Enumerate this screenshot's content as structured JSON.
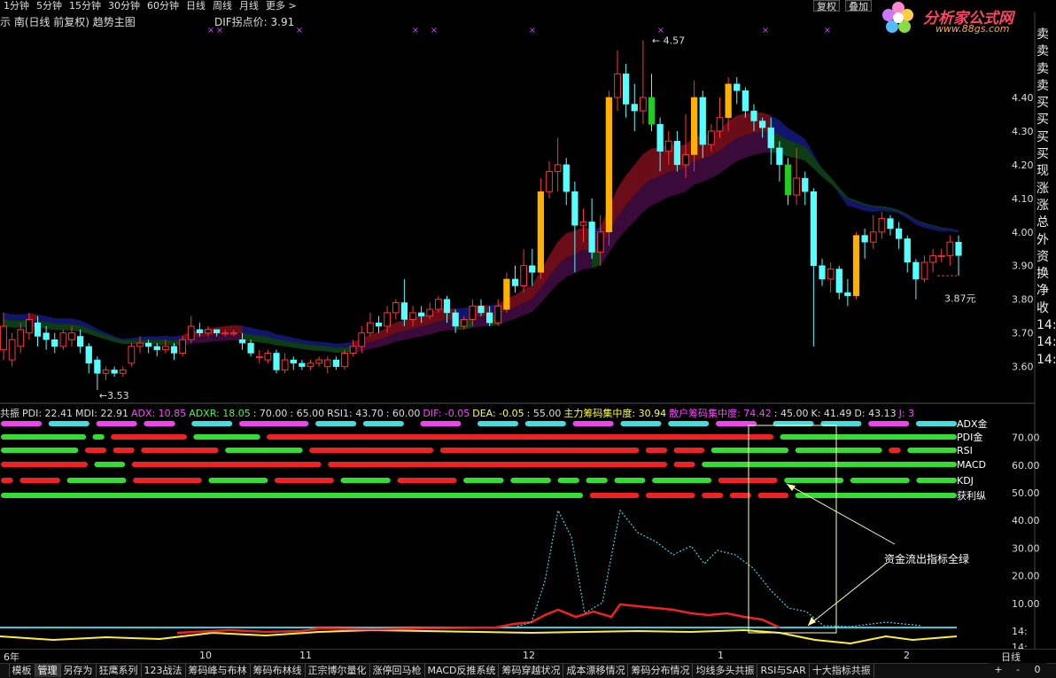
{
  "toolbar": {
    "items": [
      "1分钟",
      "5分钟",
      "15分钟",
      "30分钟",
      "60分钟",
      "日线",
      "周线",
      "月线",
      "更多 >"
    ],
    "restore_btn": "复权",
    "overlay_btn": "叠加"
  },
  "chart_header": {
    "title": "示 南(日线 前复权) 趋势主图",
    "dif_label": "DIF拐点价: 3.91"
  },
  "logo": {
    "name": "分析家公式网",
    "url": "www.88gs.com"
  },
  "price_axis": [
    "4.40",
    "4.30",
    "4.20",
    "4.10",
    "4.00",
    "3.90",
    "3.80",
    "3.70",
    "3.60"
  ],
  "annotations": {
    "high": "4.57",
    "low": "3.53",
    "last": "3.87元"
  },
  "right_panel": [
    "卖",
    "卖",
    "卖",
    "卖",
    "买",
    "买",
    "买",
    "买",
    "现",
    "涨",
    "涨",
    "总",
    "外",
    "资",
    "换",
    "净",
    "收",
    "14:",
    "14:",
    "14:"
  ],
  "indicator_line": [
    {
      "text": "共振",
      "color": "#dddddd"
    },
    {
      "text": "PDI: 22.41",
      "color": "#dddddd"
    },
    {
      "text": "MDI: 22.91",
      "color": "#dddddd"
    },
    {
      "text": "ADX: 10.85",
      "color": "#ff44ff"
    },
    {
      "text": "ADXR: 18.05",
      "color": "#55ee55"
    },
    {
      "text": ": 70.00",
      "color": "#dddddd"
    },
    {
      "text": ": 65.00",
      "color": "#dddddd"
    },
    {
      "text": "RSI1: 43.70",
      "color": "#dddddd"
    },
    {
      "text": ": 60.00",
      "color": "#dddddd"
    },
    {
      "text": "DIF: -0.05",
      "color": "#ff44ff"
    },
    {
      "text": "DEA: -0.05",
      "color": "#ffff44"
    },
    {
      "text": ": 55.00",
      "color": "#dddddd"
    },
    {
      "text": "主力筹码集中度: 30.94",
      "color": "#ffff44"
    },
    {
      "text": "散户筹码集中度: 74.42",
      "color": "#ff44ff"
    },
    {
      "text": ": 45.00",
      "color": "#dddddd"
    },
    {
      "text": "K: 41.49",
      "color": "#dddddd"
    },
    {
      "text": "D: 43.13",
      "color": "#dddddd"
    },
    {
      "text": "J: 3",
      "color": "#ff44ff"
    }
  ],
  "signal_rows": [
    "ADX金",
    "PDI金",
    "RSI",
    "MACD",
    "KDJ",
    "获利纵"
  ],
  "sub_axis": [
    "70.00",
    "60.00",
    "50.00",
    "40.00",
    "30.00",
    "20.00",
    "10.00"
  ],
  "callout": "资金流出指标全绿",
  "x_axis": {
    "labels": [
      "6年",
      "10",
      "11",
      "12",
      "1",
      "2"
    ],
    "period": "日线"
  },
  "bottom_tabs": [
    "模板",
    "管理",
    "另存为",
    "狂鹰系列",
    "123战法",
    "筹码峰与布林",
    "筹码布林线",
    "正宗博尔量化",
    "涨停回马枪",
    "MACD反推系统",
    "筹码穿越状况",
    "成本漂移情况",
    "筹码分布情况",
    "均线多头共振",
    "RSI与SAR",
    "十大指标共振"
  ],
  "bottom_controls": [
    "+",
    "-",
    "0"
  ],
  "colors": {
    "up": "#ff3333",
    "down": "#55ffff",
    "yellow": "#ffcc00",
    "green": "#22cc22",
    "cyan": "#33ccdd"
  },
  "chart_data": {
    "type": "candlestick",
    "ylim": [
      3.52,
      4.6
    ],
    "candles": [
      [
        3.65,
        3.72,
        3.62,
        3.76
      ],
      [
        3.62,
        3.68,
        3.6,
        3.7
      ],
      [
        3.66,
        3.71,
        3.64,
        3.73
      ],
      [
        3.7,
        3.74,
        3.68,
        3.76
      ],
      [
        3.73,
        3.69,
        3.66,
        3.75
      ],
      [
        3.7,
        3.68,
        3.65,
        3.72
      ],
      [
        3.68,
        3.66,
        3.64,
        3.7
      ],
      [
        3.66,
        3.7,
        3.65,
        3.71
      ],
      [
        3.68,
        3.7,
        3.66,
        3.72
      ],
      [
        3.69,
        3.66,
        3.64,
        3.71
      ],
      [
        3.66,
        3.61,
        3.58,
        3.67
      ],
      [
        3.62,
        3.58,
        3.53,
        3.63
      ],
      [
        3.58,
        3.59,
        3.56,
        3.6
      ],
      [
        3.59,
        3.58,
        3.57,
        3.6
      ],
      [
        3.58,
        3.59,
        3.57,
        3.6
      ],
      [
        3.61,
        3.66,
        3.6,
        3.67
      ],
      [
        3.66,
        3.67,
        3.64,
        3.69
      ],
      [
        3.67,
        3.66,
        3.64,
        3.68
      ],
      [
        3.66,
        3.65,
        3.63,
        3.67
      ],
      [
        3.65,
        3.66,
        3.64,
        3.68
      ],
      [
        3.66,
        3.64,
        3.62,
        3.67
      ],
      [
        3.64,
        3.68,
        3.63,
        3.69
      ],
      [
        3.68,
        3.72,
        3.67,
        3.75
      ],
      [
        3.71,
        3.7,
        3.69,
        3.73
      ],
      [
        3.7,
        3.71,
        3.69,
        3.72
      ],
      [
        3.71,
        3.7,
        3.69,
        3.71
      ],
      [
        3.7,
        3.7,
        3.69,
        3.71
      ],
      [
        3.7,
        3.7,
        3.69,
        3.71
      ],
      [
        3.68,
        3.67,
        3.65,
        3.7
      ],
      [
        3.67,
        3.64,
        3.63,
        3.68
      ],
      [
        3.63,
        3.63,
        3.61,
        3.65
      ],
      [
        3.62,
        3.64,
        3.61,
        3.65
      ],
      [
        3.64,
        3.59,
        3.58,
        3.65
      ],
      [
        3.59,
        3.62,
        3.58,
        3.64
      ],
      [
        3.62,
        3.61,
        3.59,
        3.63
      ],
      [
        3.61,
        3.6,
        3.59,
        3.62
      ],
      [
        3.6,
        3.61,
        3.59,
        3.62
      ],
      [
        3.61,
        3.62,
        3.6,
        3.63
      ],
      [
        3.6,
        3.62,
        3.58,
        3.63
      ],
      [
        3.62,
        3.6,
        3.59,
        3.63
      ],
      [
        3.6,
        3.64,
        3.59,
        3.65
      ],
      [
        3.64,
        3.66,
        3.63,
        3.68
      ],
      [
        3.66,
        3.7,
        3.64,
        3.72
      ],
      [
        3.7,
        3.73,
        3.69,
        3.76
      ],
      [
        3.73,
        3.72,
        3.7,
        3.75
      ],
      [
        3.72,
        3.76,
        3.7,
        3.78
      ],
      [
        3.76,
        3.79,
        3.74,
        3.8
      ],
      [
        3.79,
        3.74,
        3.72,
        3.86
      ],
      [
        3.74,
        3.76,
        3.72,
        3.78
      ],
      [
        3.76,
        3.75,
        3.73,
        3.78
      ],
      [
        3.75,
        3.77,
        3.74,
        3.79
      ],
      [
        3.77,
        3.8,
        3.76,
        3.81
      ],
      [
        3.8,
        3.76,
        3.73,
        3.81
      ],
      [
        3.76,
        3.72,
        3.7,
        3.77
      ],
      [
        3.72,
        3.74,
        3.71,
        3.75
      ],
      [
        3.74,
        3.78,
        3.72,
        3.8
      ],
      [
        3.78,
        3.76,
        3.75,
        3.8
      ],
      [
        3.76,
        3.73,
        3.72,
        3.78
      ],
      [
        3.73,
        3.78,
        3.72,
        3.8
      ],
      [
        3.77,
        3.86,
        3.76,
        3.88
      ],
      [
        3.86,
        3.84,
        3.82,
        3.9
      ],
      [
        3.84,
        3.9,
        3.82,
        3.95
      ],
      [
        3.9,
        3.88,
        3.84,
        3.95
      ],
      [
        3.88,
        4.12,
        3.86,
        4.16
      ],
      [
        4.12,
        4.18,
        4.1,
        4.21
      ],
      [
        4.18,
        4.2,
        4.12,
        4.28
      ],
      [
        4.2,
        4.12,
        4.08,
        4.22
      ],
      [
        4.12,
        4.02,
        3.88,
        4.15
      ],
      [
        4.02,
        4.03,
        3.97,
        4.07
      ],
      [
        4.03,
        3.94,
        3.92,
        4.1
      ],
      [
        3.94,
        4.0,
        3.9,
        4.05
      ],
      [
        4.0,
        4.4,
        3.96,
        4.42
      ],
      [
        4.4,
        4.47,
        4.36,
        4.54
      ],
      [
        4.47,
        4.38,
        4.34,
        4.5
      ],
      [
        4.38,
        4.36,
        4.3,
        4.44
      ],
      [
        4.36,
        4.4,
        4.32,
        4.57
      ],
      [
        4.4,
        4.32,
        4.3,
        4.47
      ],
      [
        4.32,
        4.24,
        4.18,
        4.34
      ],
      [
        4.24,
        4.27,
        4.2,
        4.3
      ],
      [
        4.27,
        4.2,
        4.18,
        4.3
      ],
      [
        4.2,
        4.23,
        4.16,
        4.35
      ],
      [
        4.23,
        4.4,
        4.18,
        4.45
      ],
      [
        4.4,
        4.26,
        4.22,
        4.42
      ],
      [
        4.26,
        4.3,
        4.24,
        4.32
      ],
      [
        4.3,
        4.34,
        4.28,
        4.4
      ],
      [
        4.34,
        4.44,
        4.3,
        4.46
      ],
      [
        4.44,
        4.42,
        4.38,
        4.46
      ],
      [
        4.42,
        4.36,
        4.34,
        4.43
      ],
      [
        4.36,
        4.33,
        4.3,
        4.38
      ],
      [
        4.33,
        4.31,
        4.28,
        4.34
      ],
      [
        4.31,
        4.25,
        4.2,
        4.34
      ],
      [
        4.25,
        4.2,
        4.15,
        4.27
      ],
      [
        4.2,
        4.11,
        4.08,
        4.22
      ],
      [
        4.11,
        4.16,
        4.08,
        4.25
      ],
      [
        4.16,
        4.12,
        4.08,
        4.18
      ],
      [
        4.12,
        3.9,
        3.66,
        4.13
      ],
      [
        3.9,
        3.86,
        3.84,
        3.92
      ],
      [
        3.86,
        3.89,
        3.82,
        3.91
      ],
      [
        3.89,
        3.82,
        3.8,
        3.9
      ],
      [
        3.82,
        3.81,
        3.78,
        3.86
      ],
      [
        3.81,
        3.99,
        3.8,
        4.0
      ],
      [
        3.99,
        3.97,
        3.92,
        4.01
      ],
      [
        3.97,
        4.0,
        3.95,
        4.05
      ],
      [
        4.0,
        4.04,
        3.98,
        4.06
      ],
      [
        4.04,
        4.01,
        3.99,
        4.05
      ],
      [
        4.01,
        3.98,
        3.95,
        4.03
      ],
      [
        3.98,
        3.91,
        3.88,
        3.99
      ],
      [
        3.91,
        3.86,
        3.8,
        3.92
      ],
      [
        3.86,
        3.91,
        3.85,
        3.93
      ],
      [
        3.91,
        3.93,
        3.88,
        3.95
      ],
      [
        3.93,
        3.93,
        3.91,
        3.95
      ],
      [
        3.93,
        3.97,
        3.9,
        3.99
      ],
      [
        3.97,
        3.93,
        3.87,
        3.99
      ]
    ]
  }
}
